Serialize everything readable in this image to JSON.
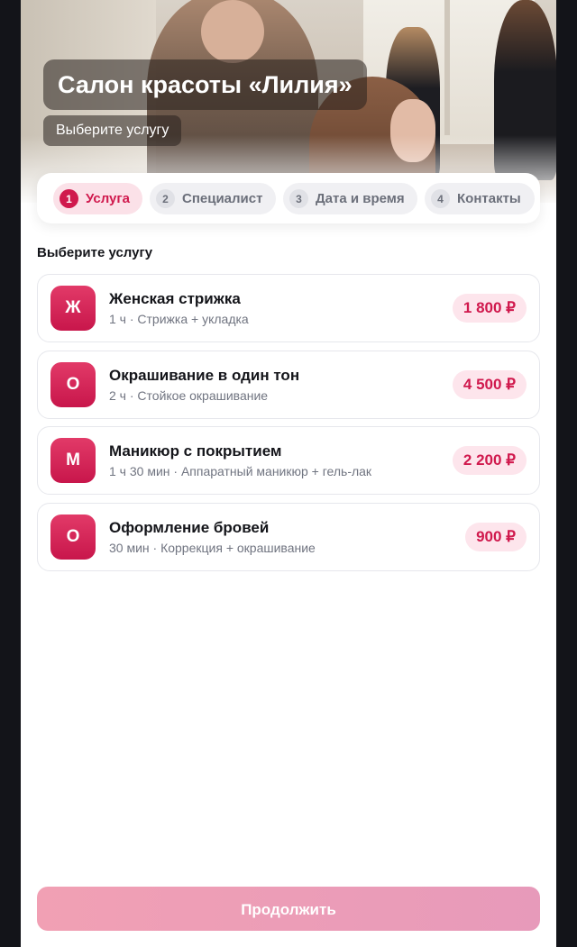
{
  "header": {
    "title": "Салон красоты «Лилия»",
    "subtitle": "Выберите услугу"
  },
  "steps": [
    {
      "number": "1",
      "label": "Услуга",
      "active": true
    },
    {
      "number": "2",
      "label": "Специалист",
      "active": false
    },
    {
      "number": "3",
      "label": "Дата и время",
      "active": false
    },
    {
      "number": "4",
      "label": "Контакты",
      "active": false
    }
  ],
  "section_title": "Выберите услугу",
  "services": [
    {
      "initial": "Ж",
      "name": "Женская стрижка",
      "details": "1 ч · Стрижка + укладка",
      "price": "1 800 ₽"
    },
    {
      "initial": "О",
      "name": "Окрашивание в один тон",
      "details": "2 ч · Стойкое окрашивание",
      "price": "4 500 ₽"
    },
    {
      "initial": "М",
      "name": "Маникюр с покрытием",
      "details": "1 ч 30 мин · Аппаратный маникюр + гель-лак",
      "price": "2 200 ₽"
    },
    {
      "initial": "О",
      "name": "Оформление бровей",
      "details": "30 мин · Коррекция + окрашивание",
      "price": "900 ₽"
    }
  ],
  "continue_label": "Продолжить",
  "colors": {
    "accent": "#d0194d",
    "accent_soft": "#fde5ec",
    "page_background": "#131419"
  }
}
